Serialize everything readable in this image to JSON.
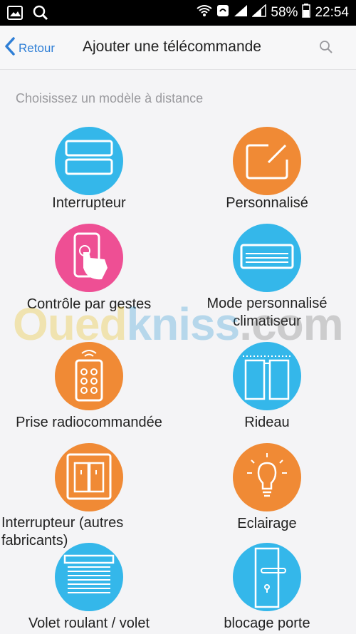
{
  "status_bar": {
    "battery": "58%",
    "time": "22:54",
    "left_icons": [
      "image-icon",
      "search-icon"
    ],
    "right_icons": [
      "wifi-icon",
      "notification-icon",
      "signal-icon",
      "signal-icon",
      "battery-icon"
    ]
  },
  "header": {
    "back_label": "Retour",
    "title": "Ajouter une télécommande"
  },
  "section": {
    "subtitle": "Choisissez un modèle à distance"
  },
  "items": [
    {
      "label": "Interrupteur",
      "icon": "switch-icon",
      "color": "#34b7ea"
    },
    {
      "label": "Personnalisé",
      "icon": "edit-icon",
      "color": "#f08a35"
    },
    {
      "label": "Contrôle par gestes",
      "icon": "phone-gesture-icon",
      "color": "#ee4f94"
    },
    {
      "label": "Mode personnalisé climatiseur",
      "icon": "air-conditioner-icon",
      "color": "#34b7ea"
    },
    {
      "label": "Prise radiocommandée",
      "icon": "remote-control-icon",
      "color": "#f08a35"
    },
    {
      "label": "Rideau",
      "icon": "curtain-icon",
      "color": "#34b7ea"
    },
    {
      "label": "Interrupteur (autres fabricants)",
      "icon": "wall-switch-icon",
      "color": "#f08a35"
    },
    {
      "label": "Eclairage",
      "icon": "light-bulb-icon",
      "color": "#f08a35"
    },
    {
      "label": "Volet roulant / volet",
      "icon": "roller-shutter-icon",
      "color": "#34b7ea"
    },
    {
      "label": "blocage porte",
      "icon": "door-lock-icon",
      "color": "#34b7ea"
    }
  ],
  "watermark": {
    "part1": "Oued",
    "part2": "kniss",
    "part3": ".com"
  }
}
